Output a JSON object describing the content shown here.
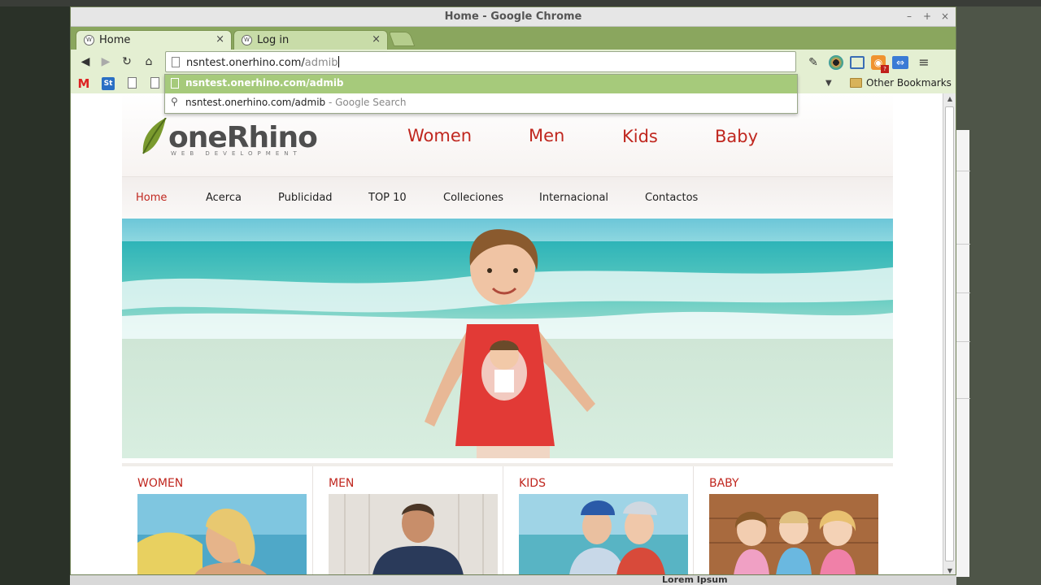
{
  "window": {
    "title": "Home - Google Chrome",
    "controls": [
      "–",
      "+",
      "×"
    ]
  },
  "tabs": [
    {
      "label": "Home",
      "active": true
    },
    {
      "label": "Log in",
      "active": false
    }
  ],
  "omnibox": {
    "typed": "nsntest.onerhino.com/",
    "completion": "admib"
  },
  "suggestions": [
    {
      "text": "nsntest.onerhino.com/admib",
      "hint": "",
      "selected": true
    },
    {
      "text": "nsntest.onerhino.com/admib",
      "hint": " - Google Search",
      "selected": false
    }
  ],
  "bookmarks": {
    "other": "Other Bookmarks",
    "st_label": "St"
  },
  "site": {
    "logo": "oneRhino",
    "logo_sub": "WEB DEVELOPMENT",
    "top_categories": [
      "Women",
      "Men",
      "Kids",
      "Baby"
    ],
    "menu": [
      "Home",
      "Acerca",
      "Publicidad",
      "TOP 10",
      "Colleciones",
      "Internacional",
      "Contactos"
    ],
    "sections": [
      "WOMEN",
      "MEN",
      "KIDS",
      "BABY"
    ],
    "accent": "#c0271f"
  },
  "taskbar": {
    "footer_text": "Lorem Ipsum"
  }
}
